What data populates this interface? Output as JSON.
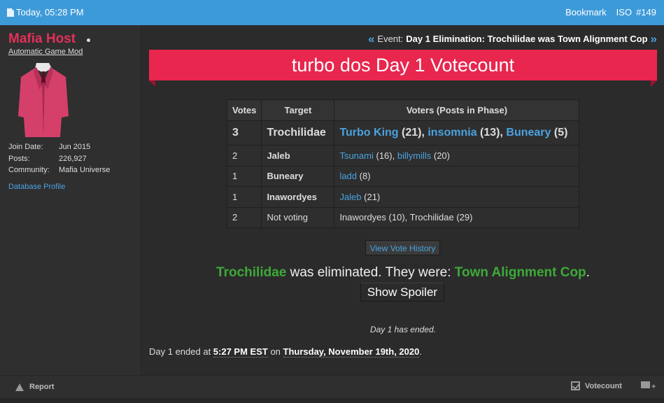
{
  "topbar": {
    "date_label": "Today, 05:28 PM",
    "bookmark_label": "Bookmark",
    "iso_label": "ISO",
    "post_number": "#149"
  },
  "user": {
    "name": "Mafia Host",
    "title": "Automatic Game Mod",
    "info": [
      {
        "key": "Join Date:",
        "value": "Jun 2015"
      },
      {
        "key": "Posts:",
        "value": "226,927"
      },
      {
        "key": "Community:",
        "value": "Mafia Universe"
      }
    ],
    "database_profile_label": "Database Profile",
    "avatar_color": "#d4406a"
  },
  "event": {
    "prefix": "Event:",
    "text": "Day 1 Elimination: Trochilidae was Town Alignment Cop"
  },
  "banner": {
    "title": "turbo dos Day 1 Votecount",
    "color": "#e8264e"
  },
  "vote_table": {
    "headers": [
      "Votes",
      "Target",
      "Voters (Posts in Phase)"
    ],
    "rows": [
      {
        "votes": "3",
        "target": "Trochilidae",
        "voters": [
          {
            "name": "Turbo King",
            "posts": "(21)"
          },
          {
            "name": "insomnia",
            "posts": "(13)"
          },
          {
            "name": "Buneary",
            "posts": "(5)"
          }
        ]
      },
      {
        "votes": "2",
        "target": "Jaleb",
        "voters": [
          {
            "name": "Tsunami",
            "posts": "(16)"
          },
          {
            "name": "billymills",
            "posts": "(20)"
          }
        ]
      },
      {
        "votes": "1",
        "target": "Buneary",
        "voters": [
          {
            "name": "ladd",
            "posts": "(8)"
          }
        ]
      },
      {
        "votes": "1",
        "target": "Inawordyes",
        "voters": [
          {
            "name": "Jaleb",
            "posts": "(21)"
          }
        ]
      },
      {
        "votes": "2",
        "target": "Not voting",
        "voters_text": "Inawordyes (10), Trochilidae (29)"
      }
    ]
  },
  "view_vote_history_label": "View Vote History",
  "elimination": {
    "player": "Trochilidae",
    "middle": " was eliminated. They were: ",
    "role": "Town Alignment Cop",
    "end": "."
  },
  "spoiler_label": "Show Spoiler",
  "phase_ended": "Day 1 has ended.",
  "end_line": {
    "prefix": "Day 1 ended at ",
    "time": "5:27 PM EST",
    "on": " on ",
    "date": "Thursday, November 19th, 2020",
    "suffix": "."
  },
  "footer": {
    "report_label": "Report",
    "votecount_label": "Votecount"
  },
  "colors": {
    "topbar": "#3d9ad9",
    "link": "#4aa3e0",
    "green": "#3daa38",
    "username": "#e2305a"
  }
}
